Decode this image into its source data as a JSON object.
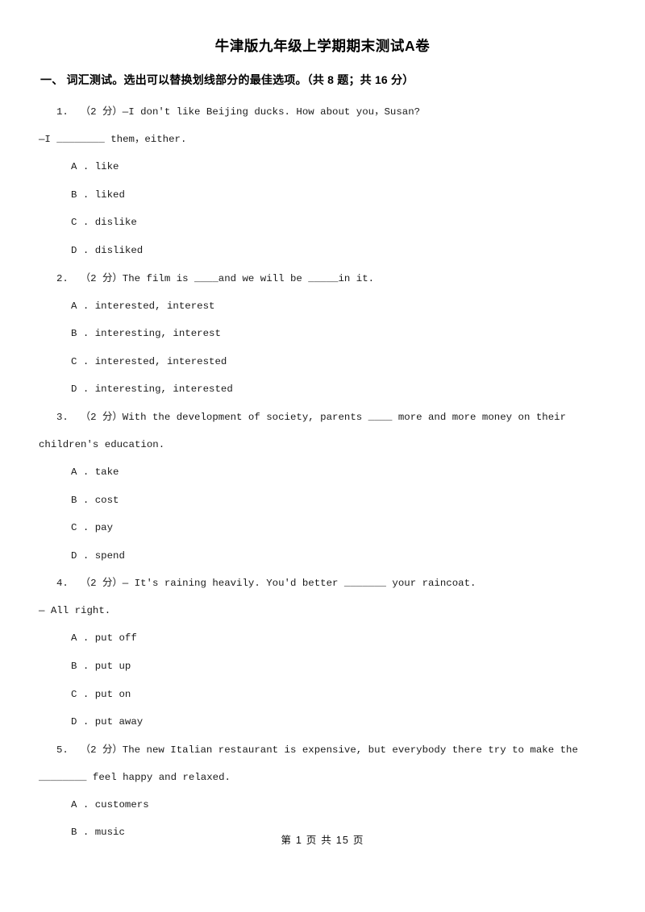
{
  "document": {
    "title": "牛津版九年级上学期期末测试A卷",
    "footer": "第 1 页 共 15 页"
  },
  "section": {
    "label": "一、 词汇测试。选出可以替换划线部分的最佳选项。（共 8 题；共 16 分）"
  },
  "questions": [
    {
      "number": "1.",
      "points": "（2 分）",
      "stem_line1": "1.  （2 分）—I don't like Beijing ducks. How about you，Susan?",
      "stem_line2": "—I ________ them，either.",
      "options": [
        "A . like",
        "B . liked",
        "C . dislike",
        "D . disliked"
      ]
    },
    {
      "number": "2.",
      "points": "（2 分）",
      "stem_line1": "2.  （2 分）The film is ____and we will be _____in it.",
      "options": [
        "A . interested, interest",
        "B . interesting, interest",
        "C . interested, interested",
        "D . interesting, interested"
      ]
    },
    {
      "number": "3.",
      "points": "（2 分）",
      "stem_line1": "3.  （2 分）With the development of society, parents ____ more and more money on their",
      "stem_line2": "children's education.",
      "options": [
        "A . take",
        "B . cost",
        "C . pay",
        "D . spend"
      ]
    },
    {
      "number": "4.",
      "points": "（2 分）",
      "stem_line1": "4.  （2 分）— It's raining heavily. You'd better _______ your raincoat.",
      "stem_line2": "— All right.",
      "options": [
        "A . put off",
        "B . put up",
        "C . put on",
        "D . put away"
      ]
    },
    {
      "number": "5.",
      "points": "（2 分）",
      "stem_line1": "5.  （2 分）The new Italian restaurant is expensive, but everybody there try to make the",
      "stem_line2": "________ feel happy and relaxed.",
      "options": [
        "A . customers",
        "B . music"
      ]
    }
  ]
}
